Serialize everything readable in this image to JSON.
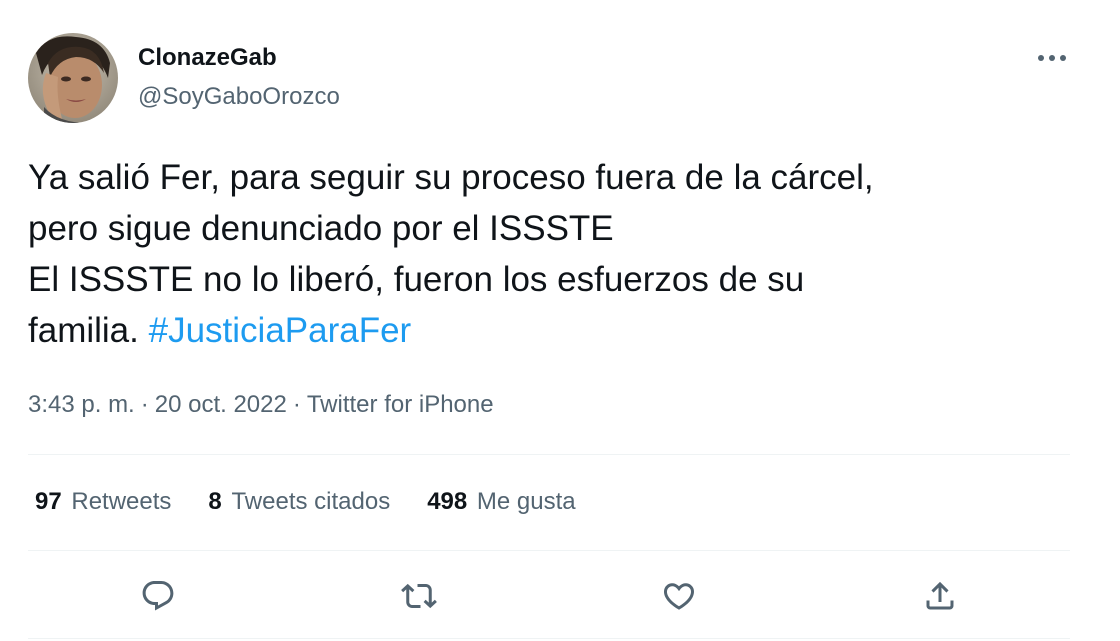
{
  "author": {
    "display_name": "ClonazeGab",
    "handle": "@SoyGaboOrozco"
  },
  "tweet": {
    "lines": [
      "Ya salió Fer, para seguir su proceso fuera de la cárcel,",
      "pero sigue denunciado por el ISSSTE",
      "El ISSSTE no lo liberó, fueron los esfuerzos de su"
    ],
    "last_line_text": "familia.",
    "hashtag": "#JusticiaParaFer"
  },
  "meta": {
    "time": "3:43 p. m.",
    "separator": "·",
    "date": "20 oct. 2022",
    "source": "Twitter for iPhone"
  },
  "stats": {
    "retweets_count": "97",
    "retweets_label": "Retweets",
    "quotes_count": "8",
    "quotes_label": "Tweets citados",
    "likes_count": "498",
    "likes_label": "Me gusta"
  },
  "colors": {
    "accent": "#1d9bf0",
    "text_primary": "#0f1419",
    "text_secondary": "#536471",
    "divider": "#eff3f4"
  },
  "icons": {
    "more": "more-dots-icon",
    "reply": "reply-icon",
    "retweet": "retweet-icon",
    "like": "heart-icon",
    "share": "share-icon"
  }
}
